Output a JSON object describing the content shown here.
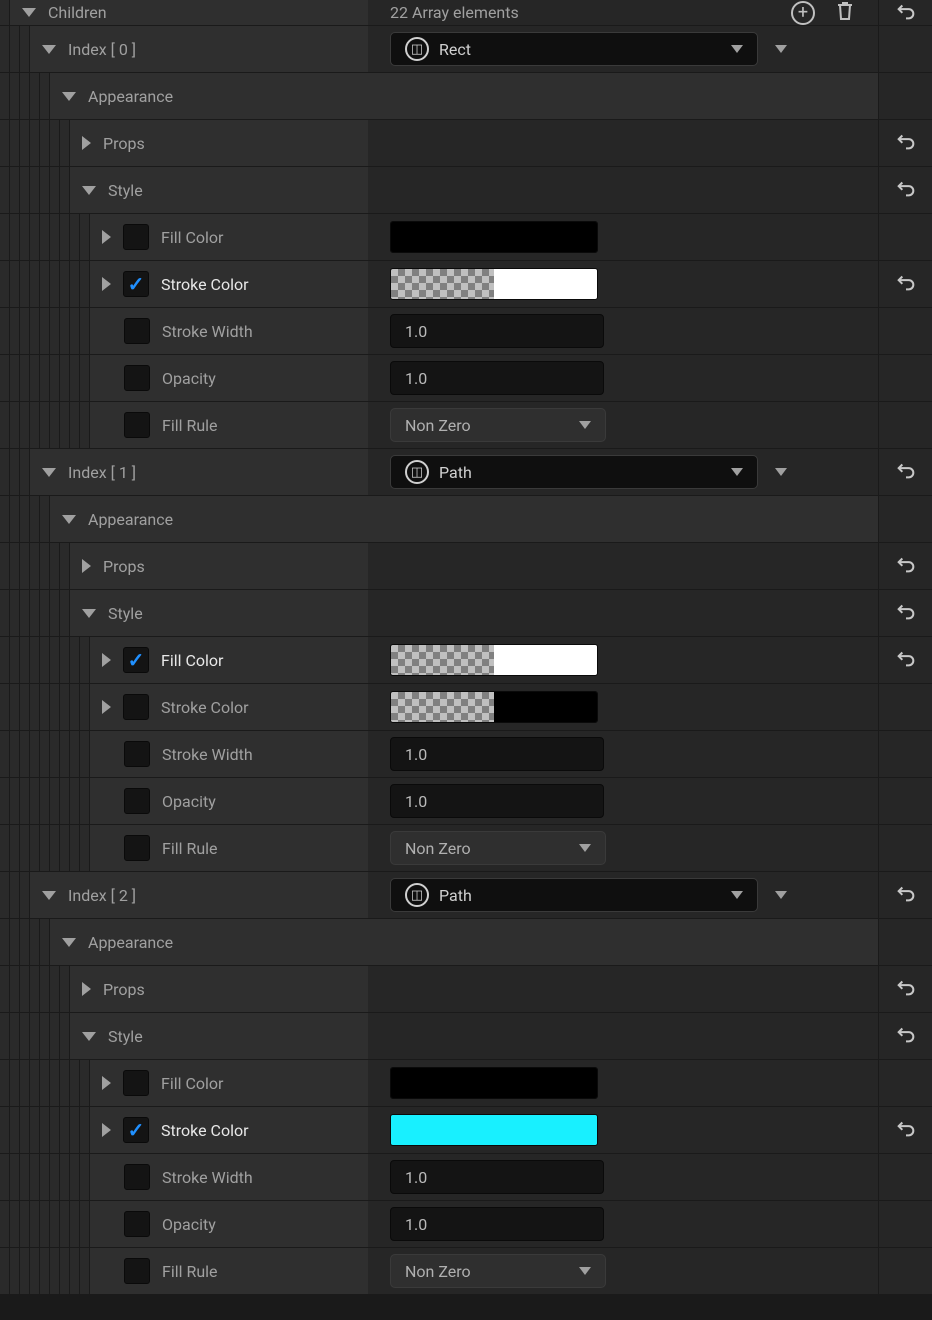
{
  "header": {
    "label": "Children",
    "count_text": "22 Array elements"
  },
  "items": [
    {
      "index_label": "Index [ 0 ]",
      "type": "Rect",
      "appearance_label": "Appearance",
      "props_label": "Props",
      "style_label": "Style",
      "fill_color_label": "Fill Color",
      "fill_color_checked": false,
      "fill_swatch": {
        "mode": "solid",
        "color": "#000000"
      },
      "stroke_color_label": "Stroke Color",
      "stroke_color_checked": true,
      "stroke_swatch": {
        "mode": "half-checker",
        "color": "#ffffff"
      },
      "stroke_width_label": "Stroke Width",
      "stroke_width_value": "1.0",
      "opacity_label": "Opacity",
      "opacity_value": "1.0",
      "fill_rule_label": "Fill Rule",
      "fill_rule_value": "Non Zero",
      "reset_props": true,
      "reset_style": true,
      "reset_stroke_color": true,
      "reset_index": false
    },
    {
      "index_label": "Index [ 1 ]",
      "type": "Path",
      "appearance_label": "Appearance",
      "props_label": "Props",
      "style_label": "Style",
      "fill_color_label": "Fill Color",
      "fill_color_checked": true,
      "fill_swatch": {
        "mode": "half-checker",
        "color": "#ffffff"
      },
      "stroke_color_label": "Stroke Color",
      "stroke_color_checked": false,
      "stroke_swatch": {
        "mode": "half-checker",
        "color": "#000000"
      },
      "stroke_width_label": "Stroke Width",
      "stroke_width_value": "1.0",
      "opacity_label": "Opacity",
      "opacity_value": "1.0",
      "fill_rule_label": "Fill Rule",
      "fill_rule_value": "Non Zero",
      "reset_props": true,
      "reset_style": true,
      "reset_fill_color": true,
      "reset_index": true
    },
    {
      "index_label": "Index [ 2 ]",
      "type": "Path",
      "appearance_label": "Appearance",
      "props_label": "Props",
      "style_label": "Style",
      "fill_color_label": "Fill Color",
      "fill_color_checked": false,
      "fill_swatch": {
        "mode": "solid",
        "color": "#000000"
      },
      "stroke_color_label": "Stroke Color",
      "stroke_color_checked": true,
      "stroke_swatch": {
        "mode": "solid",
        "color": "#18f0ff"
      },
      "stroke_width_label": "Stroke Width",
      "stroke_width_value": "1.0",
      "opacity_label": "Opacity",
      "opacity_value": "1.0",
      "fill_rule_label": "Fill Rule",
      "fill_rule_value": "Non Zero",
      "reset_props": true,
      "reset_style": true,
      "reset_stroke_color": true,
      "reset_index": true
    }
  ]
}
